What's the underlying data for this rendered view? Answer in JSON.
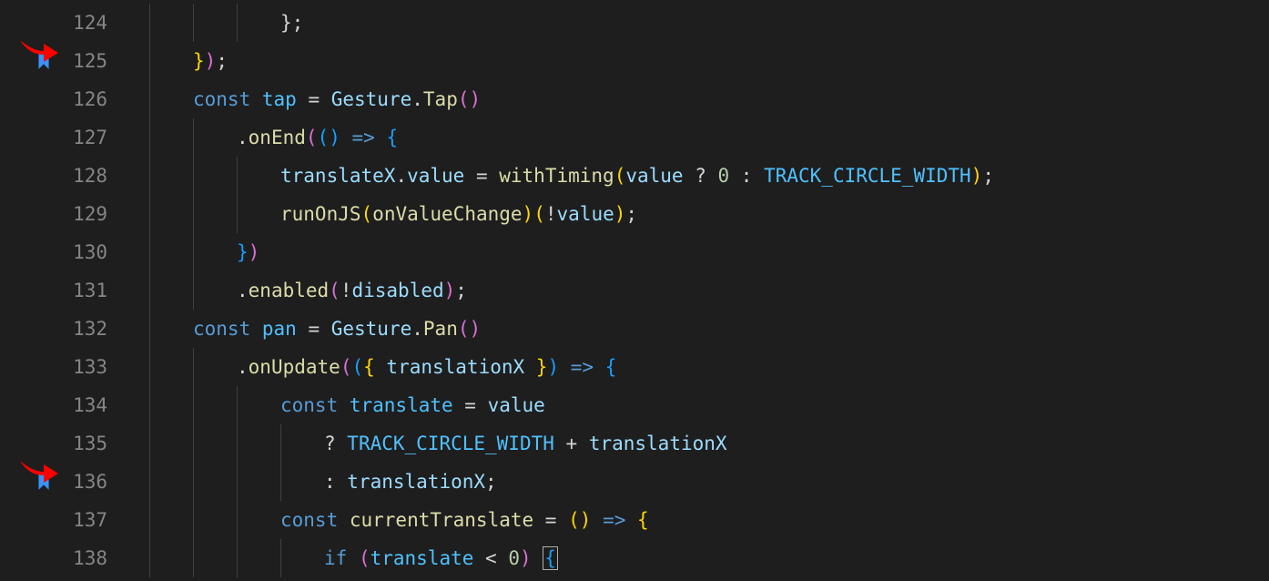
{
  "editor": {
    "lines": [
      {
        "num": 124,
        "bookmark": false,
        "indent": 3,
        "tokens": [
          {
            "t": "};",
            "c": "punc"
          }
        ]
      },
      {
        "num": 125,
        "bookmark": true,
        "indent": 1,
        "tokens": [
          {
            "t": "}",
            "c": "paren-y"
          },
          {
            "t": ")",
            "c": "paren-p"
          },
          {
            "t": ";",
            "c": "punc"
          }
        ]
      },
      {
        "num": 126,
        "bookmark": false,
        "indent": 1,
        "tokens": [
          {
            "t": "const ",
            "c": "keyword"
          },
          {
            "t": "tap",
            "c": "const"
          },
          {
            "t": " = ",
            "c": "op"
          },
          {
            "t": "Gesture",
            "c": "ident"
          },
          {
            "t": ".",
            "c": "punc"
          },
          {
            "t": "Tap",
            "c": "func"
          },
          {
            "t": "(",
            "c": "paren-p"
          },
          {
            "t": ")",
            "c": "paren-p"
          }
        ]
      },
      {
        "num": 127,
        "bookmark": false,
        "indent": 2,
        "tokens": [
          {
            "t": ".",
            "c": "punc"
          },
          {
            "t": "onEnd",
            "c": "func"
          },
          {
            "t": "(",
            "c": "paren-p"
          },
          {
            "t": "(",
            "c": "paren-b"
          },
          {
            "t": ")",
            "c": "paren-b"
          },
          {
            "t": " ",
            "c": "op"
          },
          {
            "t": "=>",
            "c": "keyword"
          },
          {
            "t": " ",
            "c": "op"
          },
          {
            "t": "{",
            "c": "paren-b"
          }
        ]
      },
      {
        "num": 128,
        "bookmark": false,
        "indent": 3,
        "tokens": [
          {
            "t": "translateX",
            "c": "ident"
          },
          {
            "t": ".",
            "c": "punc"
          },
          {
            "t": "value",
            "c": "ident"
          },
          {
            "t": " = ",
            "c": "op"
          },
          {
            "t": "withTiming",
            "c": "func"
          },
          {
            "t": "(",
            "c": "paren-y"
          },
          {
            "t": "value",
            "c": "ident"
          },
          {
            "t": " ? ",
            "c": "op"
          },
          {
            "t": "0",
            "c": "num"
          },
          {
            "t": " : ",
            "c": "op"
          },
          {
            "t": "TRACK_CIRCLE_WIDTH",
            "c": "const"
          },
          {
            "t": ")",
            "c": "paren-y"
          },
          {
            "t": ";",
            "c": "punc"
          }
        ]
      },
      {
        "num": 129,
        "bookmark": false,
        "indent": 3,
        "tokens": [
          {
            "t": "runOnJS",
            "c": "func"
          },
          {
            "t": "(",
            "c": "paren-y"
          },
          {
            "t": "onValueChange",
            "c": "func"
          },
          {
            "t": ")",
            "c": "paren-y"
          },
          {
            "t": "(",
            "c": "paren-y"
          },
          {
            "t": "!",
            "c": "op"
          },
          {
            "t": "value",
            "c": "ident"
          },
          {
            "t": ")",
            "c": "paren-y"
          },
          {
            "t": ";",
            "c": "punc"
          }
        ]
      },
      {
        "num": 130,
        "bookmark": false,
        "indent": 2,
        "tokens": [
          {
            "t": "}",
            "c": "paren-b"
          },
          {
            "t": ")",
            "c": "paren-p"
          }
        ]
      },
      {
        "num": 131,
        "bookmark": false,
        "indent": 2,
        "tokens": [
          {
            "t": ".",
            "c": "punc"
          },
          {
            "t": "enabled",
            "c": "func"
          },
          {
            "t": "(",
            "c": "paren-p"
          },
          {
            "t": "!",
            "c": "op"
          },
          {
            "t": "disabled",
            "c": "ident"
          },
          {
            "t": ")",
            "c": "paren-p"
          },
          {
            "t": ";",
            "c": "punc"
          }
        ]
      },
      {
        "num": 132,
        "bookmark": false,
        "indent": 1,
        "tokens": [
          {
            "t": "const ",
            "c": "keyword"
          },
          {
            "t": "pan",
            "c": "const"
          },
          {
            "t": " = ",
            "c": "op"
          },
          {
            "t": "Gesture",
            "c": "ident"
          },
          {
            "t": ".",
            "c": "punc"
          },
          {
            "t": "Pan",
            "c": "func"
          },
          {
            "t": "(",
            "c": "paren-p"
          },
          {
            "t": ")",
            "c": "paren-p"
          }
        ]
      },
      {
        "num": 133,
        "bookmark": false,
        "indent": 2,
        "tokens": [
          {
            "t": ".",
            "c": "punc"
          },
          {
            "t": "onUpdate",
            "c": "func"
          },
          {
            "t": "(",
            "c": "paren-p"
          },
          {
            "t": "(",
            "c": "paren-b"
          },
          {
            "t": "{ ",
            "c": "paren-y"
          },
          {
            "t": "translationX",
            "c": "ident"
          },
          {
            "t": " }",
            "c": "paren-y"
          },
          {
            "t": ")",
            "c": "paren-b"
          },
          {
            "t": " ",
            "c": "op"
          },
          {
            "t": "=>",
            "c": "keyword"
          },
          {
            "t": " ",
            "c": "op"
          },
          {
            "t": "{",
            "c": "paren-b"
          }
        ]
      },
      {
        "num": 134,
        "bookmark": false,
        "indent": 3,
        "tokens": [
          {
            "t": "const ",
            "c": "keyword"
          },
          {
            "t": "translate",
            "c": "const"
          },
          {
            "t": " = ",
            "c": "op"
          },
          {
            "t": "value",
            "c": "ident"
          }
        ]
      },
      {
        "num": 135,
        "bookmark": false,
        "indent": 4,
        "tokens": [
          {
            "t": "? ",
            "c": "op"
          },
          {
            "t": "TRACK_CIRCLE_WIDTH",
            "c": "const"
          },
          {
            "t": " + ",
            "c": "op"
          },
          {
            "t": "translationX",
            "c": "ident"
          }
        ]
      },
      {
        "num": 136,
        "bookmark": true,
        "indent": 4,
        "tokens": [
          {
            "t": ": ",
            "c": "op"
          },
          {
            "t": "translationX",
            "c": "ident"
          },
          {
            "t": ";",
            "c": "punc"
          }
        ]
      },
      {
        "num": 137,
        "bookmark": false,
        "indent": 3,
        "tokens": [
          {
            "t": "const ",
            "c": "keyword"
          },
          {
            "t": "currentTranslate",
            "c": "func"
          },
          {
            "t": " = ",
            "c": "op"
          },
          {
            "t": "(",
            "c": "paren-y"
          },
          {
            "t": ")",
            "c": "paren-y"
          },
          {
            "t": " ",
            "c": "op"
          },
          {
            "t": "=>",
            "c": "keyword"
          },
          {
            "t": " ",
            "c": "op"
          },
          {
            "t": "{",
            "c": "paren-y"
          }
        ]
      },
      {
        "num": 138,
        "bookmark": false,
        "indent": 4,
        "tokens": [
          {
            "t": "if ",
            "c": "keyword"
          },
          {
            "t": "(",
            "c": "paren-p"
          },
          {
            "t": "translate",
            "c": "const"
          },
          {
            "t": " < ",
            "c": "op"
          },
          {
            "t": "0",
            "c": "num"
          },
          {
            "t": ")",
            "c": "paren-p"
          },
          {
            "t": " ",
            "c": "op"
          },
          {
            "t": "{",
            "c": "paren-b",
            "cursor": true
          }
        ]
      }
    ]
  },
  "annotations": {
    "arrows": [
      {
        "line": 125
      },
      {
        "line": 136
      }
    ]
  },
  "colors": {
    "bookmark": "#3794ff",
    "arrow": "#ff0000"
  }
}
